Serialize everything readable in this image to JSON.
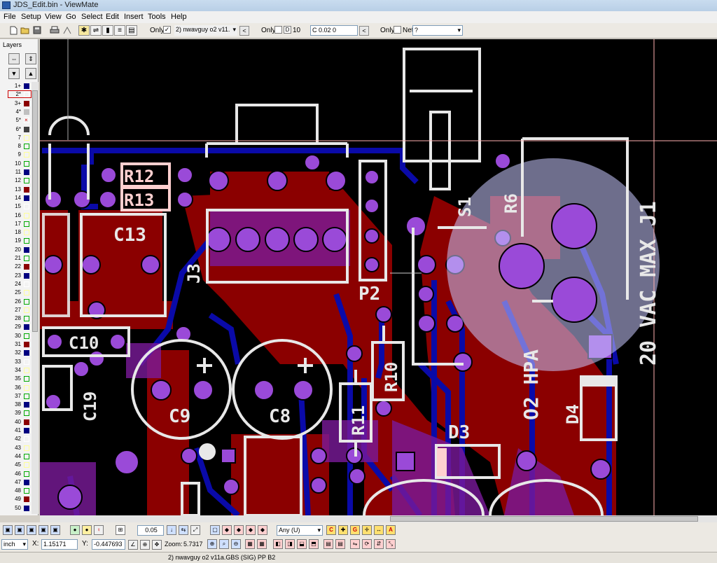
{
  "window": {
    "title": "JDS_Edit.bin - ViewMate"
  },
  "menu": [
    "File",
    "Setup",
    "View",
    "Go",
    "Select",
    "Edit",
    "Insert",
    "Tools",
    "Help"
  ],
  "toolbar": {
    "only_label_1": "Only",
    "layer_dropdown": "2) nwavguy o2 v11.",
    "only_label_2": "Only",
    "d_label": "D",
    "dcode_value": "10",
    "aperture_value": "C 0.02  0",
    "only_label_3": "Only",
    "net_label": "Net",
    "net_value": "?",
    "arrow_left": "<"
  },
  "layers_panel": {
    "title": "Layers",
    "rows": [
      {
        "num": "1+",
        "color": "#000080"
      },
      {
        "num": "2*",
        "color": "#ffffff",
        "selected": true
      },
      {
        "num": "3+",
        "color": "#8b0000"
      },
      {
        "num": "4*",
        "color": "#c0c0c0"
      },
      {
        "num": "5*",
        "color": "#ffffff",
        "crossed": true
      },
      {
        "num": "6*",
        "color": "#404040"
      },
      {
        "num": "7",
        "color": "#ffff99"
      },
      {
        "num": "8",
        "color": "#00aa00"
      },
      {
        "num": "9",
        "color": "#ffff99"
      },
      {
        "num": "10",
        "color": "#00aa00"
      },
      {
        "num": "11",
        "color": "#000080"
      },
      {
        "num": "12",
        "color": "#00aa00"
      },
      {
        "num": "13",
        "color": "#8b0000"
      },
      {
        "num": "14",
        "color": "#000080"
      },
      {
        "num": "15",
        "color": "#ffffff"
      },
      {
        "num": "16",
        "color": "#ffff99"
      },
      {
        "num": "17",
        "color": "#00aa00"
      },
      {
        "num": "18",
        "color": "#ffff99"
      },
      {
        "num": "19",
        "color": "#00aa00"
      },
      {
        "num": "20",
        "color": "#000080"
      },
      {
        "num": "21",
        "color": "#00aa00"
      },
      {
        "num": "22",
        "color": "#8b0000"
      },
      {
        "num": "23",
        "color": "#000080"
      },
      {
        "num": "24",
        "color": "#ffffff"
      },
      {
        "num": "25",
        "color": "#ffff99"
      },
      {
        "num": "26",
        "color": "#00aa00"
      },
      {
        "num": "27",
        "color": "#ffff99"
      },
      {
        "num": "28",
        "color": "#00aa00"
      },
      {
        "num": "29",
        "color": "#000080"
      },
      {
        "num": "30",
        "color": "#00aa00"
      },
      {
        "num": "31",
        "color": "#8b0000"
      },
      {
        "num": "32",
        "color": "#000080"
      },
      {
        "num": "33",
        "color": "#ffffff"
      },
      {
        "num": "34",
        "color": "#ffff99"
      },
      {
        "num": "35",
        "color": "#00aa00"
      },
      {
        "num": "36",
        "color": "#ffff99"
      },
      {
        "num": "37",
        "color": "#00aa00"
      },
      {
        "num": "38",
        "color": "#000080"
      },
      {
        "num": "39",
        "color": "#00aa00"
      },
      {
        "num": "40",
        "color": "#8b0000"
      },
      {
        "num": "41",
        "color": "#000080"
      },
      {
        "num": "42",
        "color": "#ffffff"
      },
      {
        "num": "43",
        "color": "#ffff99"
      },
      {
        "num": "44",
        "color": "#00aa00"
      },
      {
        "num": "45",
        "color": "#ffff99"
      },
      {
        "num": "46",
        "color": "#00aa00"
      },
      {
        "num": "47",
        "color": "#000080"
      },
      {
        "num": "48",
        "color": "#00aa00"
      },
      {
        "num": "49",
        "color": "#8b0000"
      },
      {
        "num": "50",
        "color": "#000080"
      }
    ]
  },
  "pcb": {
    "labels": {
      "r12": "R12",
      "r13": "R13",
      "c13": "C13",
      "j3": "J3",
      "p2": "P2",
      "s1": "S1",
      "r6": "R6",
      "j1": "20 VAC MAX J1",
      "c10": "C10",
      "c19": "C19",
      "c9": "C9",
      "c8": "C8",
      "r10": "R10",
      "r11": "R11",
      "hpa": "O2 HPA",
      "d4": "D4",
      "d3": "D3",
      "plus": "+"
    }
  },
  "bottom_toolbar": {
    "value_box": "0.05",
    "mode_select": "Any  (U)",
    "g_label": "G",
    "a_label": "A"
  },
  "coords": {
    "unit": "inch",
    "x_label": "X:",
    "x_value": "1.15171",
    "y_label": "Y:",
    "y_value": "-0.447693",
    "zoom_label": "Zoom:",
    "zoom_value": "5.7317"
  },
  "status": {
    "text": "2) nwavguy o2 v11a.GBS (SIG) PP B2"
  },
  "colors": {
    "board_red": "#8b0000",
    "trace_blue": "#0a0aa8",
    "via_purple": "#8e3ac8",
    "silk": "#f0f0f0",
    "silk_pink": "#ffd0d0",
    "overlay": "#c8c8ff"
  }
}
